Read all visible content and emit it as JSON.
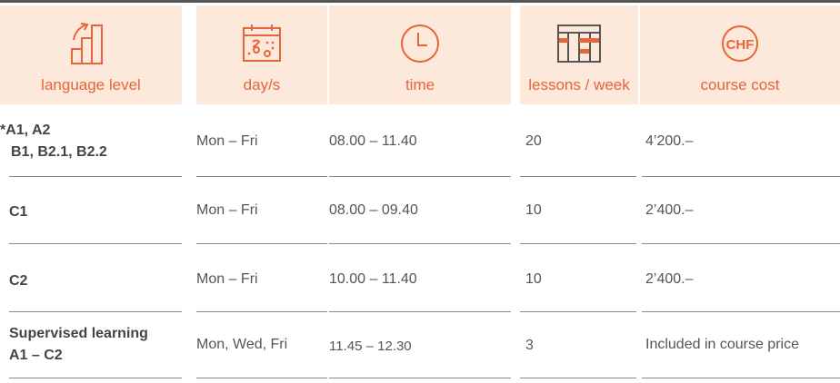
{
  "header": {
    "columns": [
      {
        "label": "language level",
        "icon": "level-chart-icon"
      },
      {
        "label": "day/s",
        "icon": "calendar-icon"
      },
      {
        "label": "time",
        "icon": "clock-icon"
      },
      {
        "label": "lessons / week",
        "icon": "schedule-grid-icon"
      },
      {
        "label": "course cost",
        "icon": "chf-coin-icon",
        "icon_text": "CHF"
      }
    ]
  },
  "rows": [
    {
      "level_line1": "*A1, A2",
      "level_line2": "B1, B2.1, B2.2",
      "days": "Mon – Fri",
      "time": "08.00 – 11.40",
      "lessons": "20",
      "cost": "4’200.–"
    },
    {
      "level_line1": "C1",
      "level_line2": "",
      "days": "Mon – Fri",
      "time": "08.00 – 09.40",
      "lessons": "10",
      "cost": "2’400.–"
    },
    {
      "level_line1": "C2",
      "level_line2": "",
      "days": "Mon – Fri",
      "time": "10.00 – 11.40",
      "lessons": "10",
      "cost": "2’400.–"
    },
    {
      "level_line1": "Supervised learning",
      "level_line2": "A1 – C2",
      "days": "Mon, Wed, Fri",
      "time": "11.45 – 12.30",
      "lessons": "3",
      "cost": "Included in course price"
    }
  ],
  "colors": {
    "accent": "#e8643a",
    "header_bg": "#fde8dc",
    "text": "#555555",
    "rule": "#8a8a8a"
  }
}
